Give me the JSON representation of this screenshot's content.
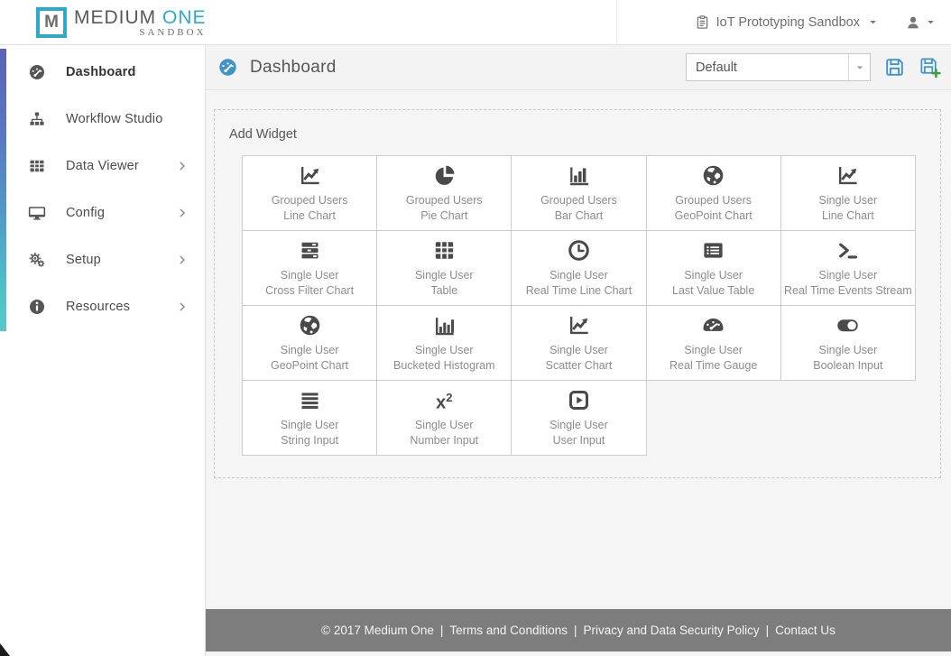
{
  "brand": {
    "logo_letter": "M",
    "name_part1": "MEDIUM",
    "name_part2": "ONE",
    "tagline": "SANDBOX"
  },
  "topbar": {
    "workspace_label": "IoT Prototyping Sandbox"
  },
  "sidebar": [
    {
      "label": "Dashboard",
      "icon": "gauge-icon",
      "active": true,
      "submenu": false
    },
    {
      "label": "Workflow Studio",
      "icon": "sitemap-icon",
      "active": false,
      "submenu": false
    },
    {
      "label": "Data Viewer",
      "icon": "table-icon",
      "active": false,
      "submenu": true
    },
    {
      "label": "Config",
      "icon": "desktop-icon",
      "active": false,
      "submenu": true
    },
    {
      "label": "Setup",
      "icon": "gears-icon",
      "active": false,
      "submenu": true
    },
    {
      "label": "Resources",
      "icon": "info-circle-icon",
      "active": false,
      "submenu": true
    }
  ],
  "content_header": {
    "title": "Dashboard",
    "select_value": "Default"
  },
  "add_widget": {
    "title": "Add Widget",
    "widgets": [
      {
        "line1": "Grouped Users",
        "line2": "Line Chart",
        "icon": "line-chart-icon"
      },
      {
        "line1": "Grouped Users",
        "line2": "Pie Chart",
        "icon": "pie-chart-icon"
      },
      {
        "line1": "Grouped Users",
        "line2": "Bar Chart",
        "icon": "bar-chart-icon"
      },
      {
        "line1": "Grouped Users",
        "line2": "GeoPoint Chart",
        "icon": "globe-icon"
      },
      {
        "line1": "Single User",
        "line2": "Line Chart",
        "icon": "line-chart-icon"
      },
      {
        "line1": "Single User",
        "line2": "Cross Filter Chart",
        "icon": "cross-filter-icon"
      },
      {
        "line1": "Single User",
        "line2": "Table",
        "icon": "table-grid-icon"
      },
      {
        "line1": "Single User",
        "line2": "Real Time Line Chart",
        "icon": "clock-icon"
      },
      {
        "line1": "Single User",
        "line2": "Last Value Table",
        "icon": "list-table-icon"
      },
      {
        "line1": "Single User",
        "line2": "Real Time Events Stream",
        "icon": "terminal-icon"
      },
      {
        "line1": "Single User",
        "line2": "GeoPoint Chart",
        "icon": "globe-icon"
      },
      {
        "line1": "Single User",
        "line2": "Bucketed Histogram",
        "icon": "histogram-icon"
      },
      {
        "line1": "Single User",
        "line2": "Scatter Chart",
        "icon": "scatter-chart-icon"
      },
      {
        "line1": "Single User",
        "line2": "Real Time Gauge",
        "icon": "gauge-semi-icon"
      },
      {
        "line1": "Single User",
        "line2": "Boolean Input",
        "icon": "toggle-icon"
      },
      {
        "line1": "Single User",
        "line2": "String Input",
        "icon": "align-justify-icon"
      },
      {
        "line1": "Single User",
        "line2": "Number Input",
        "icon": "number-x2-icon"
      },
      {
        "line1": "Single User",
        "line2": "User Input",
        "icon": "play-square-icon"
      }
    ]
  },
  "footer": {
    "copyright": "© 2017 Medium One",
    "links": [
      "Terms and Conditions",
      "Privacy and Data Security Policy",
      "Contact Us"
    ],
    "separator": "|"
  },
  "colors": {
    "brand_teal": "#2FA9CB",
    "accent_blue": "#4193C6",
    "save_plus_green": "#3F9B3F",
    "footer_bg": "#7D7D7D",
    "sidebar_gradient_top": "#5A63B7",
    "sidebar_gradient_bottom": "#4EC3C9"
  }
}
